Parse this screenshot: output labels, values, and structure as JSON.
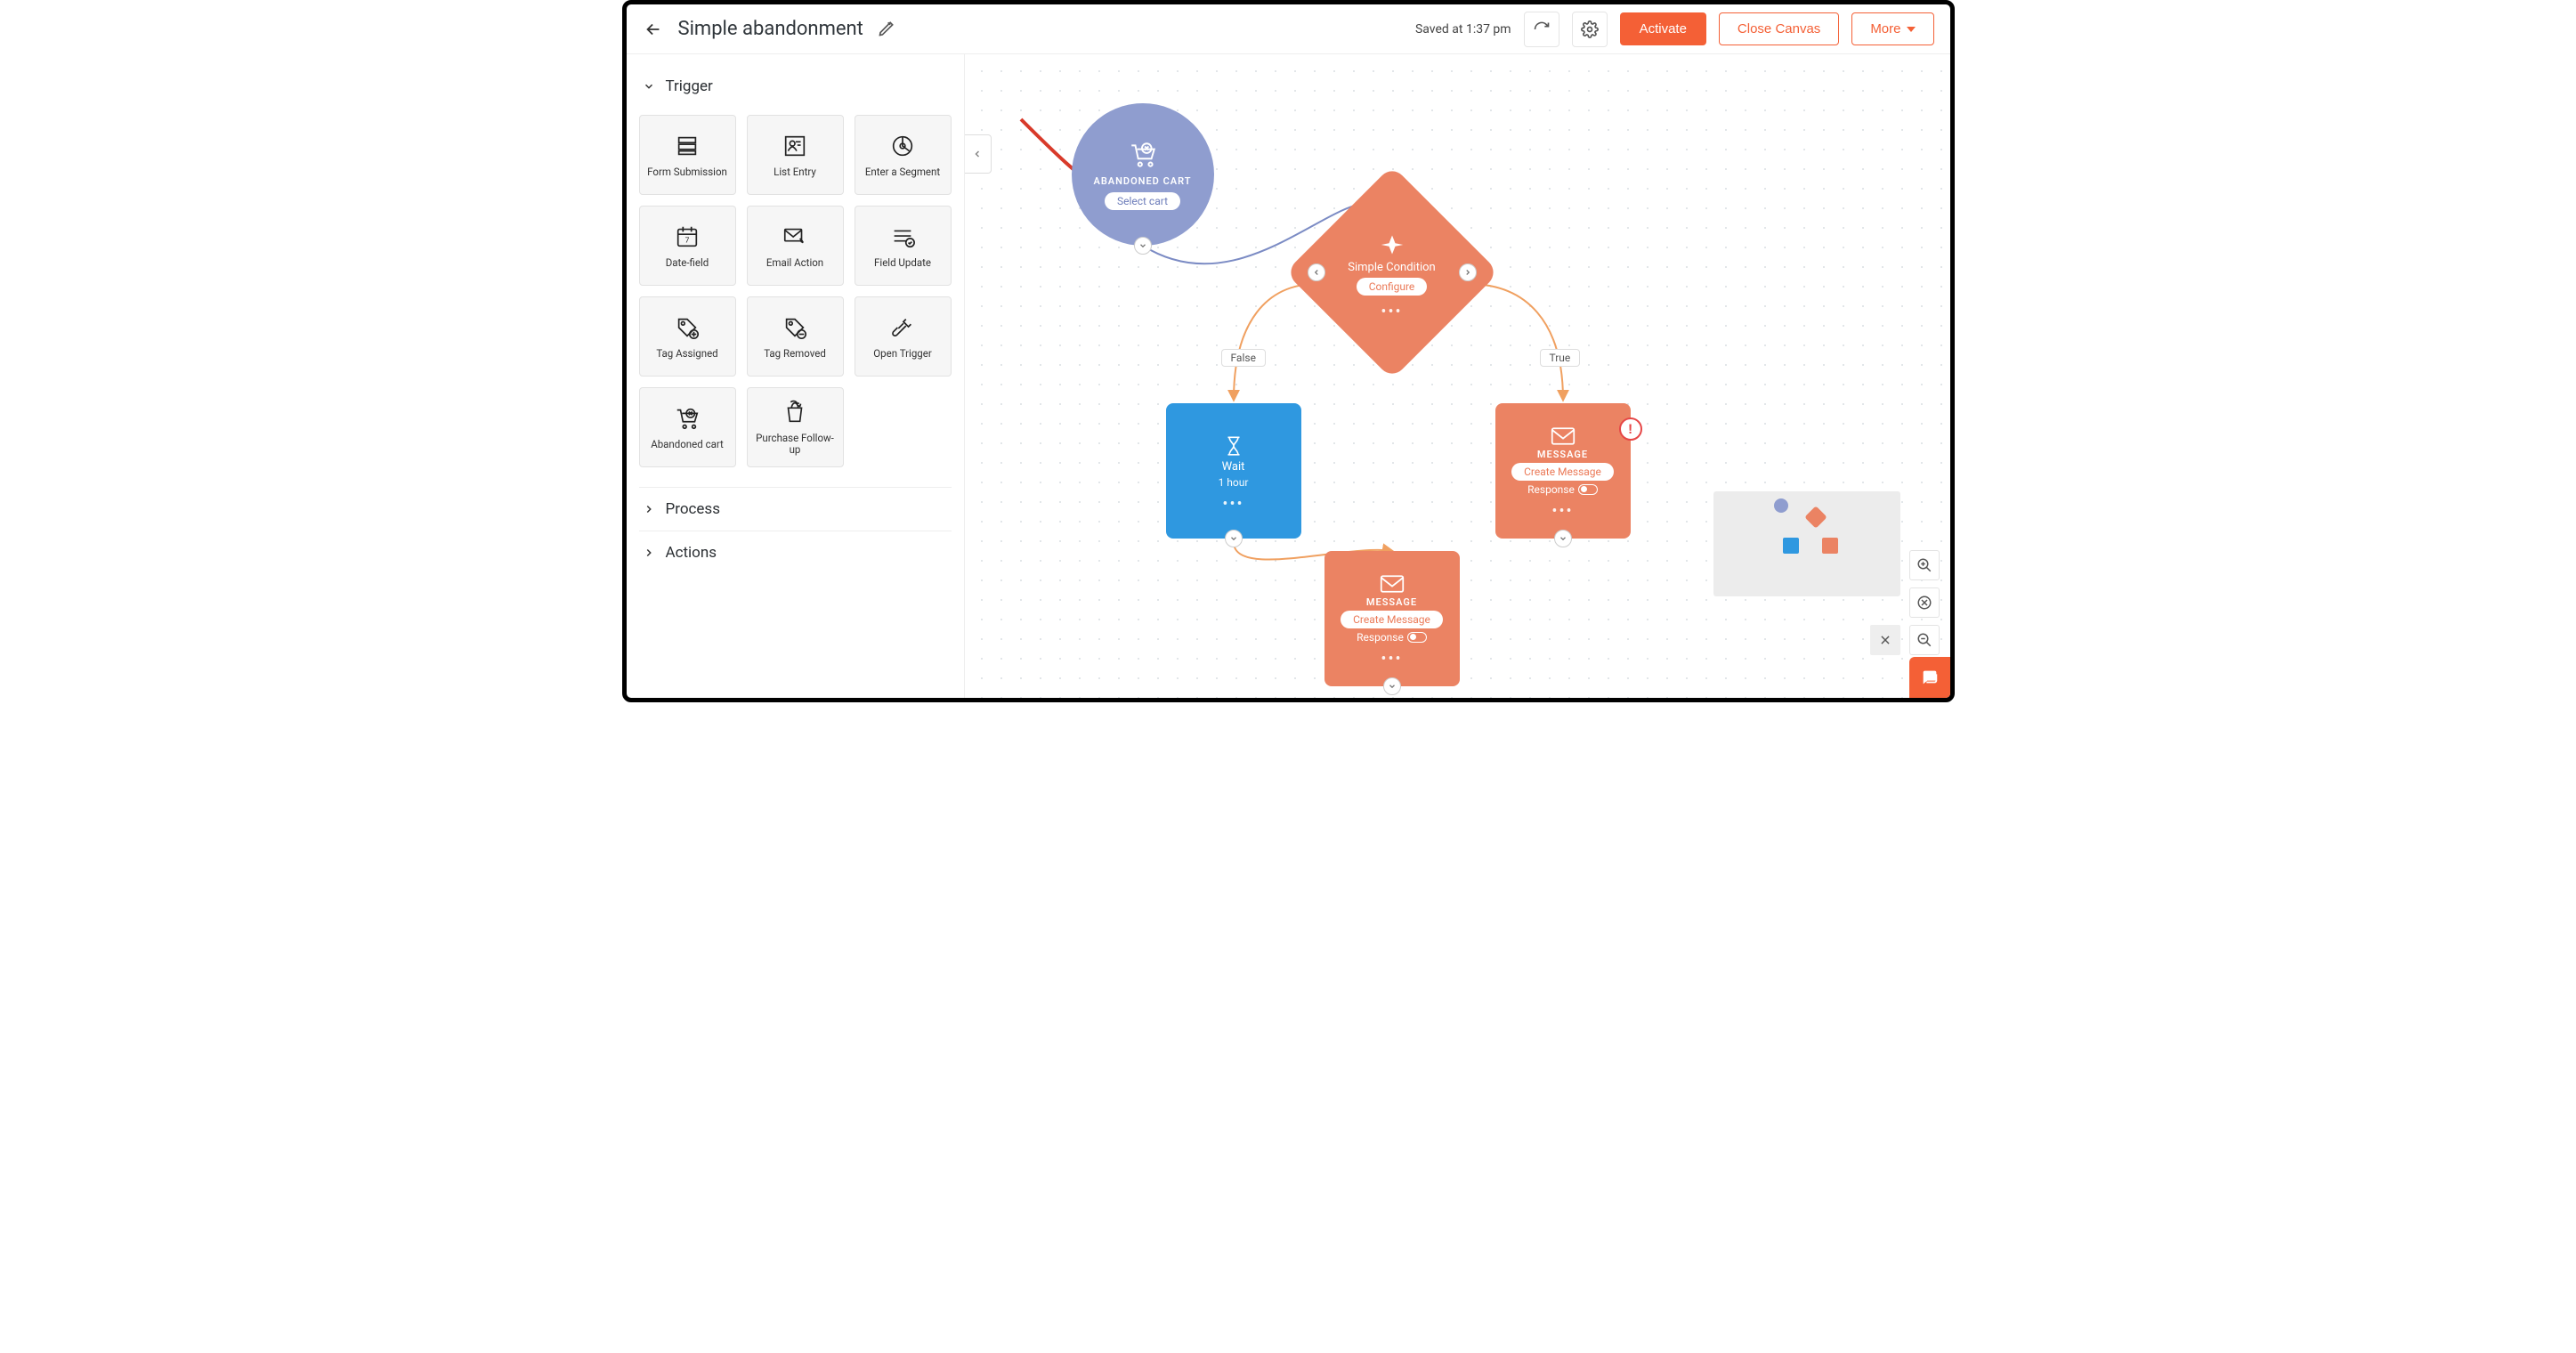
{
  "header": {
    "title": "Simple abandonment",
    "saved_text": "Saved at 1:37 pm",
    "activate_label": "Activate",
    "close_label": "Close Canvas",
    "more_label": "More"
  },
  "sidebar": {
    "sections": {
      "trigger_title": "Trigger",
      "process_title": "Process",
      "actions_title": "Actions"
    },
    "triggers": [
      {
        "label": "Form Submission"
      },
      {
        "label": "List Entry"
      },
      {
        "label": "Enter a Segment"
      },
      {
        "label": "Date-field"
      },
      {
        "label": "Email Action"
      },
      {
        "label": "Field Update"
      },
      {
        "label": "Tag Assigned"
      },
      {
        "label": "Tag Removed"
      },
      {
        "label": "Open Trigger"
      },
      {
        "label": "Abandoned cart"
      },
      {
        "label": "Purchase Follow-up"
      }
    ]
  },
  "canvas": {
    "nodes": {
      "abandoned_cart": {
        "label": "ABANDONED CART",
        "action": "Select cart"
      },
      "condition": {
        "title": "Simple Condition",
        "action": "Configure",
        "false_label": "False",
        "true_label": "True"
      },
      "wait": {
        "title": "Wait",
        "sub": "1 hour"
      },
      "message1": {
        "label": "MESSAGE",
        "action": "Create Message",
        "response": "Response"
      },
      "message2": {
        "label": "MESSAGE",
        "action": "Create Message",
        "response": "Response"
      }
    }
  },
  "colors": {
    "primary": "#f46036",
    "node_circle": "#8f9dcf",
    "node_orange": "#eb8363",
    "node_blue": "#2f98e0"
  }
}
